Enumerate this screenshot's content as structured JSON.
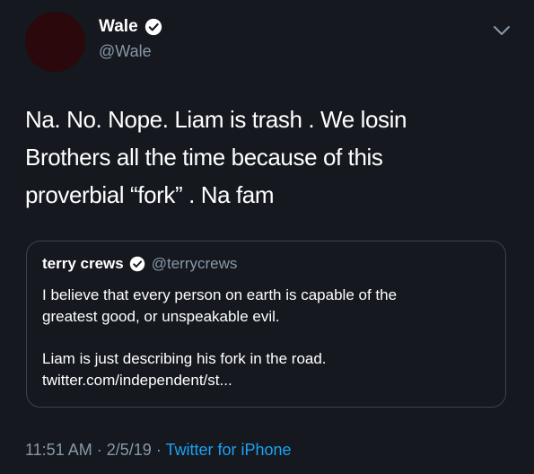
{
  "tweet": {
    "author_name": "Wale",
    "author_handle": "@Wale",
    "text_lines": [
      "Na. No. Nope. Liam is trash . We losin",
      "Brothers all the time because of this",
      "proverbial “fork” . Na fam"
    ],
    "time": "11:51 AM",
    "date": "2/5/19",
    "separator": "·",
    "source": "Twitter for iPhone"
  },
  "quoted_tweet": {
    "author_name": "terry crews",
    "author_handle": "@terrycrews",
    "paragraph1_lines": [
      "I believe that every person on earth is capable of the",
      "greatest good, or unspeakable evil."
    ],
    "paragraph2_lines": [
      "Liam is just describing his fork in the road.",
      "twitter.com/independent/st..."
    ]
  },
  "icons": {
    "verified": "verified-badge-icon",
    "menu": "chevron-down-icon"
  },
  "colors": {
    "background": "#15181f",
    "primary_text": "#ffffff",
    "secondary_text": "#8899a6",
    "link": "#1da1f2",
    "quote_border": "#3a4350",
    "avatar": "#2a080b"
  }
}
